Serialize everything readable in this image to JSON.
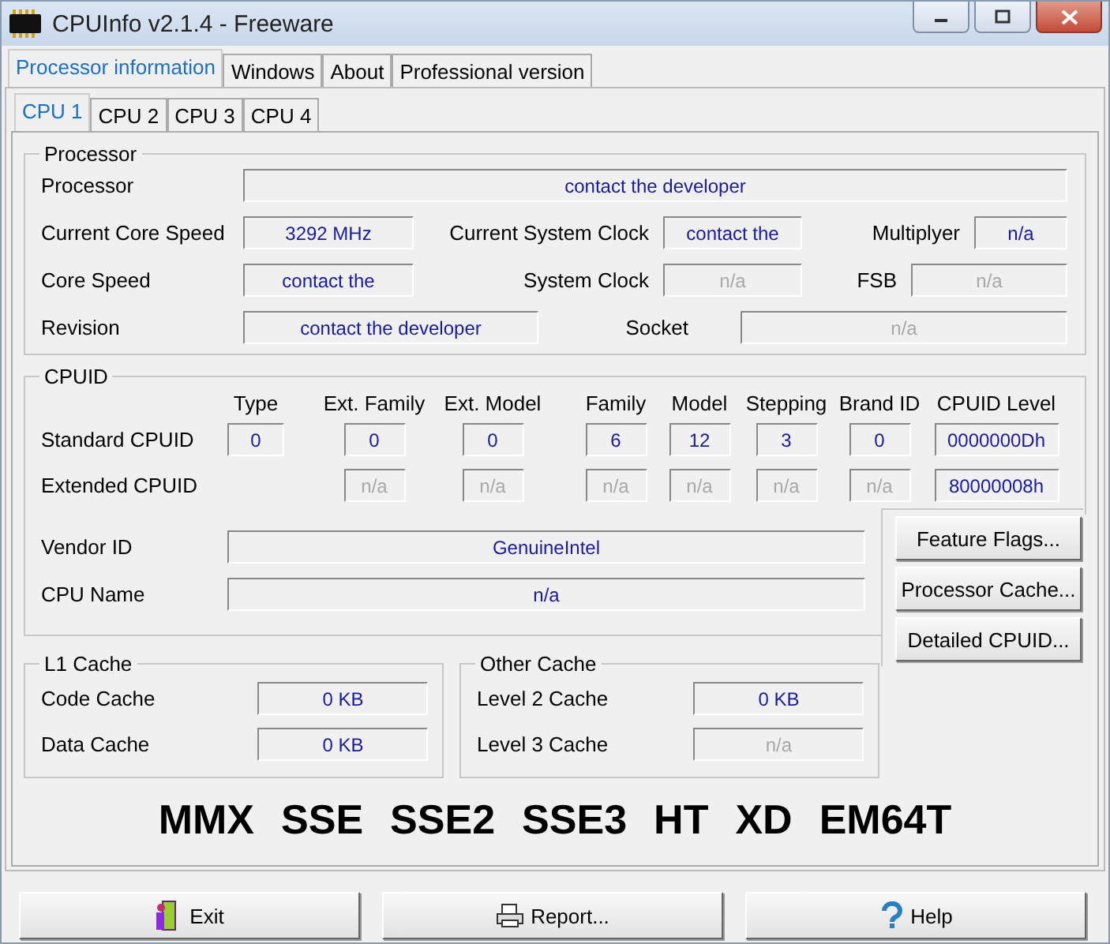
{
  "window": {
    "title": "CPUInfo v2.1.4 - Freeware"
  },
  "tabs": [
    {
      "label": "Processor information",
      "selected": true
    },
    {
      "label": "Windows",
      "selected": false
    },
    {
      "label": "About",
      "selected": false
    },
    {
      "label": "Professional version",
      "selected": false
    }
  ],
  "cpu_tabs": [
    {
      "label": "CPU 1",
      "selected": true
    },
    {
      "label": "CPU 2",
      "selected": false
    },
    {
      "label": "CPU 3",
      "selected": false
    },
    {
      "label": "CPU 4",
      "selected": false
    }
  ],
  "processor": {
    "title": "Processor",
    "rows": [
      [
        {
          "label": "Processor",
          "value": "contact the developer",
          "disabled": false
        }
      ],
      [
        {
          "label": "Current Core Speed",
          "value": "3292 MHz",
          "disabled": false
        },
        {
          "label": "Current System Clock",
          "value": "contact the",
          "disabled": false
        },
        {
          "label": "Multiplyer",
          "value": "n/a",
          "disabled": false
        }
      ],
      [
        {
          "label": "Core Speed",
          "value": "contact the",
          "disabled": false
        },
        {
          "label": "System Clock",
          "value": "n/a",
          "disabled": true
        },
        {
          "label": "FSB",
          "value": "n/a",
          "disabled": true
        }
      ],
      [
        {
          "label": "Revision",
          "value": "contact the developer",
          "disabled": false
        },
        {
          "label": "Socket",
          "value": "n/a",
          "disabled": true
        }
      ]
    ]
  },
  "cpuid": {
    "title": "CPUID",
    "columns": [
      "Type",
      "Ext. Family",
      "Ext. Model",
      "Family",
      "Model",
      "Stepping",
      "Brand ID",
      "CPUID Level"
    ],
    "rows": [
      {
        "label": "Standard CPUID",
        "cells": [
          {
            "value": "0",
            "disabled": false
          },
          {
            "value": "0",
            "disabled": false
          },
          {
            "value": "0",
            "disabled": false
          },
          {
            "value": "6",
            "disabled": false
          },
          {
            "value": "12",
            "disabled": false
          },
          {
            "value": "3",
            "disabled": false
          },
          {
            "value": "0",
            "disabled": false
          },
          {
            "value": "0000000Dh",
            "disabled": false
          }
        ]
      },
      {
        "label": "Extended CPUID",
        "cells": [
          null,
          {
            "value": "n/a",
            "disabled": true
          },
          {
            "value": "n/a",
            "disabled": true
          },
          {
            "value": "n/a",
            "disabled": true
          },
          {
            "value": "n/a",
            "disabled": true
          },
          {
            "value": "n/a",
            "disabled": true
          },
          {
            "value": "n/a",
            "disabled": true
          },
          {
            "value": "80000008h",
            "disabled": false
          }
        ]
      }
    ],
    "identity": [
      {
        "label": "Vendor ID",
        "value": "GenuineIntel",
        "disabled": false
      },
      {
        "label": "CPU Name",
        "value": "n/a",
        "disabled": false
      }
    ]
  },
  "side_buttons": [
    "Feature Flags...",
    "Processor Cache...",
    "Detailed CPUID..."
  ],
  "caches": [
    {
      "title": "L1 Cache",
      "rows": [
        {
          "label": "Code Cache",
          "value": "0 KB",
          "disabled": false
        },
        {
          "label": "Data Cache",
          "value": "0 KB",
          "disabled": false
        }
      ]
    },
    {
      "title": "Other Cache",
      "rows": [
        {
          "label": "Level 2 Cache",
          "value": "0 KB",
          "disabled": false
        },
        {
          "label": "Level 3 Cache",
          "value": "n/a",
          "disabled": true
        }
      ]
    }
  ],
  "features": [
    "MMX",
    "SSE",
    "SSE2",
    "SSE3",
    "HT",
    "XD",
    "EM64T"
  ],
  "buttons": [
    {
      "label": "Exit",
      "kind": "exit"
    },
    {
      "label": "Report...",
      "kind": "report"
    },
    {
      "label": "Help",
      "kind": "help"
    }
  ]
}
